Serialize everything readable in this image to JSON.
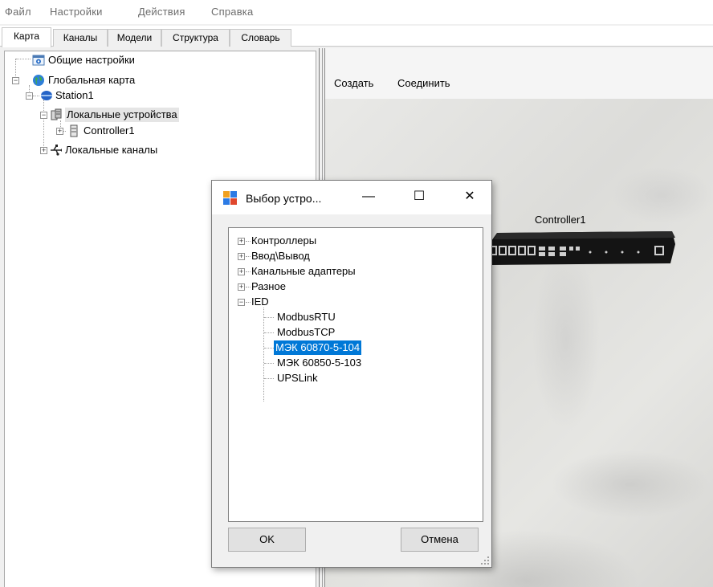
{
  "menu": [
    "Файл",
    "Настройки",
    "Действия",
    "Справка"
  ],
  "tabs": [
    "Карта",
    "Каналы",
    "Модели",
    "Структура",
    "Словарь"
  ],
  "tree": {
    "general_settings": "Общие настройки",
    "global_map": "Глобальная карта",
    "station": "Station1",
    "local_devices": "Локальные устройства",
    "controller": "Controller1",
    "local_channels": "Локальные каналы"
  },
  "toolbar": {
    "create": "Создать",
    "connect": "Соединить"
  },
  "canvas": {
    "device_label": "Controller1"
  },
  "dialog": {
    "title": "Выбор устро...",
    "minimize": "—",
    "maximize": "☐",
    "close": "✕",
    "groups": [
      "Контроллеры",
      "Ввод\\Вывод",
      "Канальные адаптеры",
      "Разное",
      "IED"
    ],
    "ied_items": [
      "ModbusRTU",
      "ModbusTCP",
      "МЭК 60870-5-104",
      "МЭК 60850-5-103",
      "UPSLink"
    ],
    "selected_item": "МЭК 60870-5-104",
    "ok": "OK",
    "cancel": "Отмена"
  }
}
